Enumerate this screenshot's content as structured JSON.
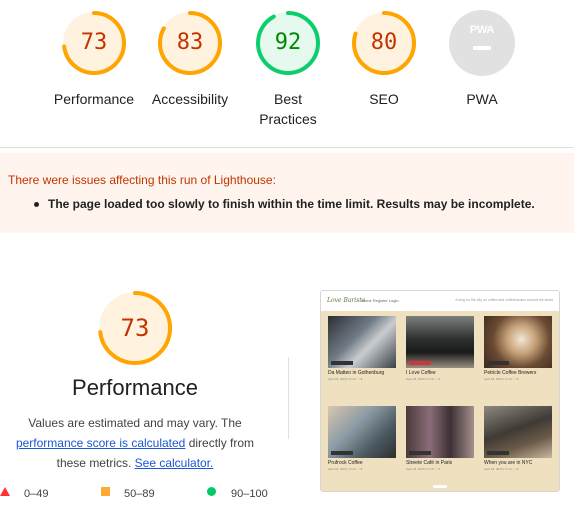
{
  "categories": [
    {
      "label": "Performance",
      "score": "73",
      "score_value": 73,
      "color": "#ffa400",
      "bg": "#fff3e0",
      "text_color": "#c33300"
    },
    {
      "label": "Accessibility",
      "score": "83",
      "score_value": 83,
      "color": "#ffa400",
      "bg": "#fff3e0",
      "text_color": "#c33300"
    },
    {
      "label": "Best Practices",
      "score": "92",
      "score_value": 92,
      "color": "#0cce6b",
      "bg": "#e6f9ee",
      "text_color": "#008800"
    },
    {
      "label": "SEO",
      "score": "80",
      "score_value": 80,
      "color": "#ffa400",
      "bg": "#fff3e0",
      "text_color": "#c33300"
    },
    {
      "label": "PWA",
      "badge": "PWA",
      "icon": "pwa-icon"
    }
  ],
  "warning": {
    "title": "There were issues affecting this run of Lighthouse:",
    "items": [
      "The page loaded too slowly to finish within the time limit. Results may be incomplete."
    ]
  },
  "performance": {
    "score": "73",
    "score_value": 73,
    "title": "Performance",
    "desc_1": "Values are estimated and may vary. The",
    "link_1": "performance score is calculated",
    "desc_2": " directly from",
    "desc_3": "these metrics. ",
    "link_2": "See calculator."
  },
  "legend": {
    "fail": "0–49",
    "average": "50–89",
    "pass": "90–100",
    "colors": {
      "fail": "#ff3333",
      "average": "#ffaa33",
      "pass": "#00cc66"
    }
  },
  "thumbnail": {
    "logo": "Love Barista",
    "nav": "Home   Register   Login",
    "tagline": "A blog for the city on coffee and coffeehouses around the world",
    "cards": [
      {
        "caption": "Da Matteo in Gothenburg",
        "meta": "April 18, 2023 | 5 min   ♡ 8"
      },
      {
        "caption": "I Love Coffee",
        "meta": "April 18, 2023 | 5 min   ♡ 8"
      },
      {
        "caption": "Petricle Coffee Brewers",
        "meta": "April 18, 2023 | 5 min   ♡ 8"
      },
      {
        "caption": "Prufrock Coffee",
        "meta": "April 18, 2023 | 5 min   ♡ 8"
      },
      {
        "caption": "Streete Café in Paris",
        "meta": "April 18, 2023 | 5 min   ♡ 8"
      },
      {
        "caption": "When you are in NYC",
        "meta": "April 18, 2023 | 5 min   ♡ 8"
      }
    ]
  }
}
